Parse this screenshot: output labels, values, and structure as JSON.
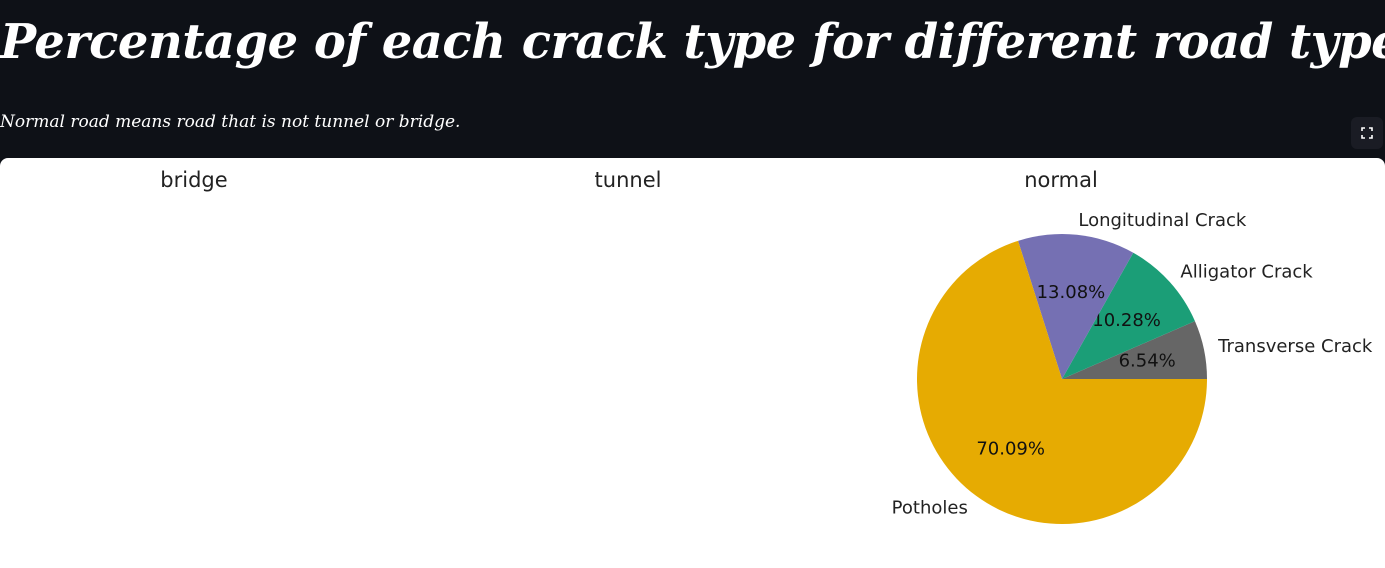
{
  "page": {
    "title": "Percentage of each crack type for different road types",
    "subtitle": "Normal road means road that is not tunnel or bridge."
  },
  "toolbar": {
    "fullscreen_icon": "fullscreen-expand-icon"
  },
  "chart_data": {
    "type": "pie",
    "subplots": [
      {
        "title": "bridge",
        "slices": []
      },
      {
        "title": "tunnel",
        "slices": []
      },
      {
        "title": "normal",
        "slices": [
          {
            "label": "Transverse Crack",
            "pct": 6.54,
            "pct_label": "6.54%",
            "color": "#666666"
          },
          {
            "label": "Alligator Crack",
            "pct": 10.28,
            "pct_label": "10.28%",
            "color": "#1b9e77"
          },
          {
            "label": "Longitudinal Crack",
            "pct": 13.08,
            "pct_label": "13.08%",
            "color": "#7570b3"
          },
          {
            "label": "Potholes",
            "pct": 70.09,
            "pct_label": "70.09%",
            "color": "#e6ab02"
          }
        ]
      }
    ]
  }
}
